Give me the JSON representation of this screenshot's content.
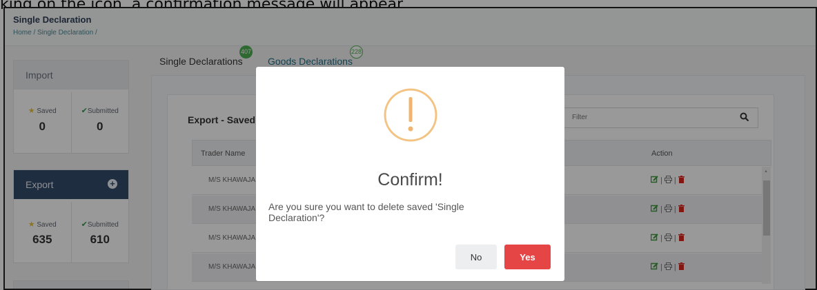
{
  "caption": "king on the icon, a confirmation message will appear.",
  "page": {
    "title": "Single Declaration",
    "breadcrumb": "Home / Single Declaration /"
  },
  "sidebar": {
    "import": {
      "label": "Import",
      "saved_label": "Saved",
      "saved_count": "0",
      "submitted_label": "Submitted",
      "submitted_count": "0"
    },
    "export": {
      "label": "Export",
      "saved_label": "Saved",
      "saved_count": "635",
      "submitted_label": "Submitted",
      "submitted_count": "610"
    }
  },
  "tabs": [
    {
      "label": "Single Declarations",
      "badge": "407"
    },
    {
      "label": "Goods Declarations",
      "badge": "228"
    }
  ],
  "table": {
    "title": "Export - Saved",
    "filter_placeholder": "Filter",
    "columns": [
      "Trader Name",
      "Action"
    ],
    "rows": [
      {
        "trader": "M/S KHAWAJA"
      },
      {
        "trader": "M/S KHAWAJA"
      },
      {
        "trader": "M/S KHAWAJA"
      },
      {
        "trader": "M/S KHAWAJA"
      }
    ]
  },
  "dialog": {
    "title": "Confirm!",
    "message": "Are you sure you want to delete saved 'Single Declaration'?",
    "no_label": "No",
    "yes_label": "Yes"
  },
  "colors": {
    "export_header": "#354b6b",
    "yes_button": "#e64545",
    "warning": "#f3c383",
    "badge_green": "#4caf50"
  }
}
